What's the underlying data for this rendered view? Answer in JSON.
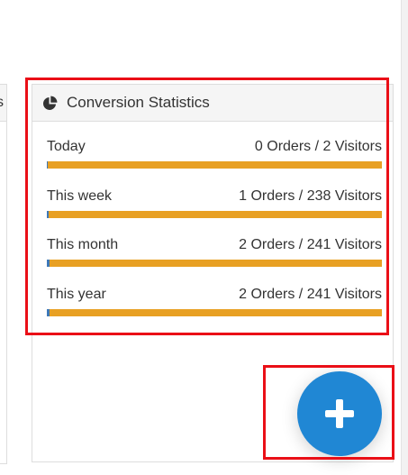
{
  "left_panel": {
    "header_fragment": "s"
  },
  "conversion_card": {
    "icon": "pie-chart-icon",
    "title": "Conversion Statistics",
    "rows": [
      {
        "label": "Today",
        "value": "0 Orders / 2 Visitors",
        "conversion_fraction": 0.0
      },
      {
        "label": "This week",
        "value": "1 Orders / 238 Visitors",
        "conversion_fraction": 0.0042
      },
      {
        "label": "This month",
        "value": "2 Orders / 241 Visitors",
        "conversion_fraction": 0.0083
      },
      {
        "label": "This year",
        "value": "2 Orders / 241 Visitors",
        "conversion_fraction": 0.0083
      }
    ],
    "bar_colors": {
      "remaining": "#e8a023",
      "converted": "#3d78b8"
    }
  },
  "fab": {
    "icon": "plus-icon",
    "color": "#2087d4"
  },
  "annotation_color": "#ea0f17"
}
